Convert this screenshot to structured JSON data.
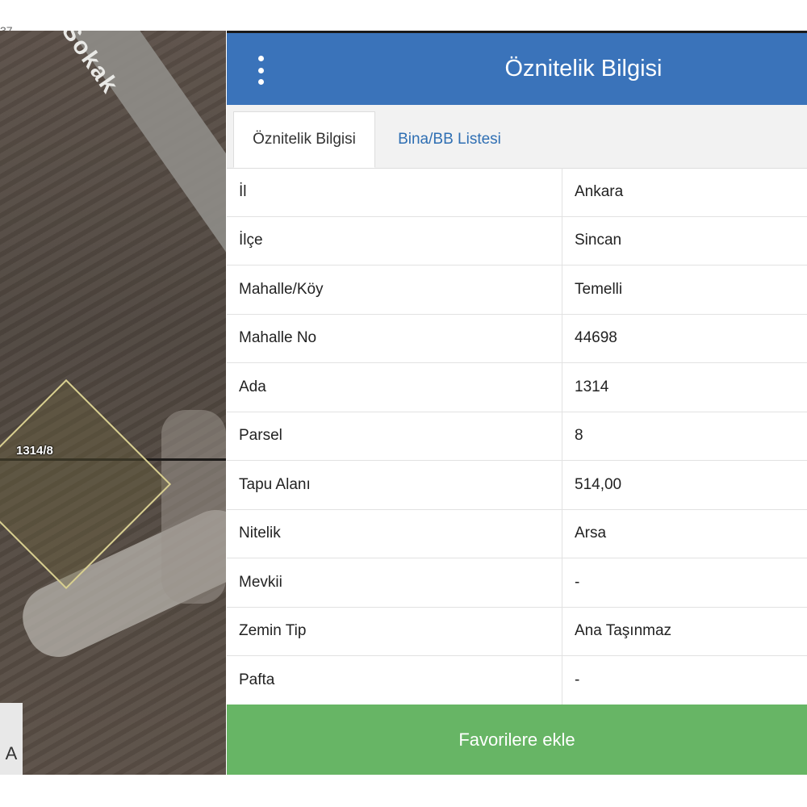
{
  "map": {
    "street_label": "Sokak",
    "parcel_label": "1314/8",
    "corner_text": "37",
    "side_button_label": "A",
    "colors": {
      "parcel_outline": "#d8cf90"
    }
  },
  "panel": {
    "title": "Öznitelik Bilgisi",
    "menu_icon": "kebab-vertical-icon",
    "colors": {
      "header": "#3a73ba",
      "button": "#67b565",
      "tab_link": "#2f6fb3"
    },
    "tabs": [
      {
        "label": "Öznitelik Bilgisi",
        "active": true
      },
      {
        "label": "Bina/BB Listesi",
        "active": false
      }
    ],
    "rows": [
      {
        "label": "İl",
        "value": "Ankara"
      },
      {
        "label": "İlçe",
        "value": "Sincan"
      },
      {
        "label": "Mahalle/Köy",
        "value": "Temelli"
      },
      {
        "label": "Mahalle No",
        "value": "44698"
      },
      {
        "label": "Ada",
        "value": "1314"
      },
      {
        "label": "Parsel",
        "value": "8"
      },
      {
        "label": "Tapu Alanı",
        "value": "514,00"
      },
      {
        "label": "Nitelik",
        "value": "Arsa"
      },
      {
        "label": "Mevkii",
        "value": "-"
      },
      {
        "label": "Zemin Tip",
        "value": "Ana Taşınmaz"
      },
      {
        "label": "Pafta",
        "value": "-"
      }
    ],
    "favorite_button_label": "Favorilere ekle"
  }
}
